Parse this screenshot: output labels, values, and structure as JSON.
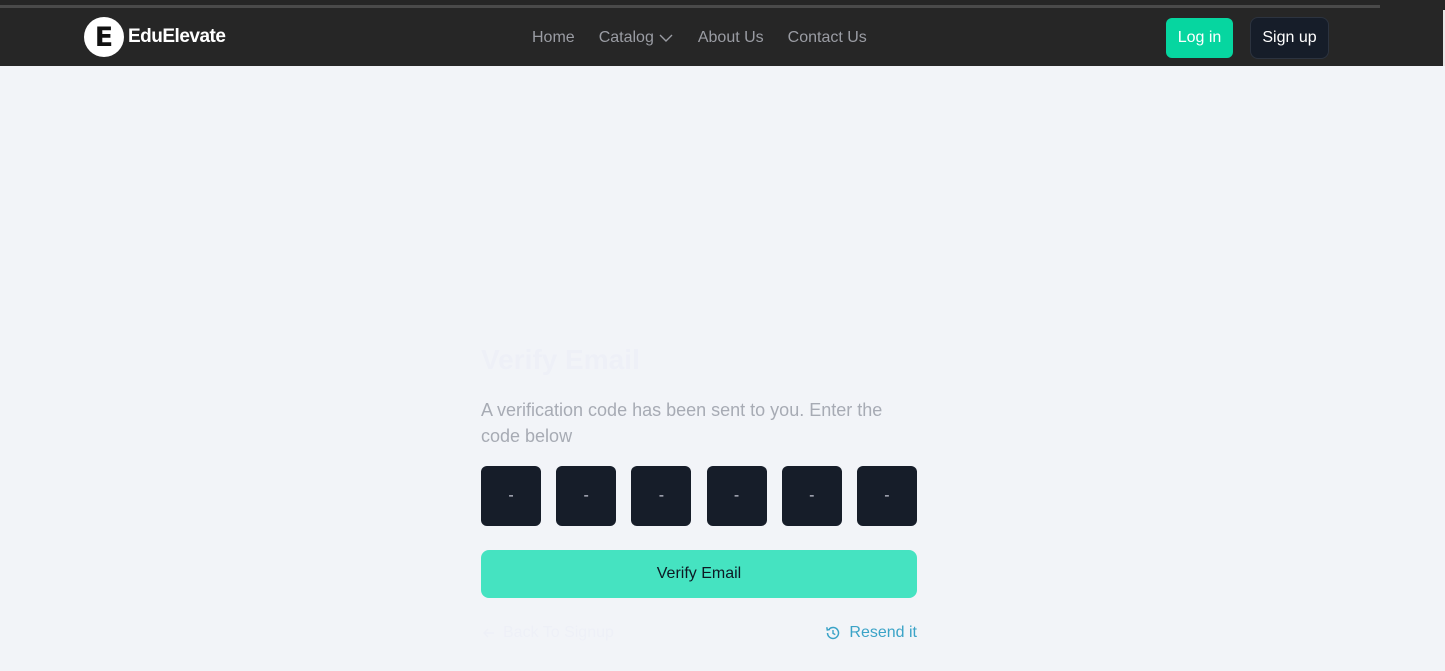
{
  "brand": {
    "name": "EduElevate",
    "logo_letter": "E"
  },
  "nav": {
    "links": [
      {
        "label": "Home"
      },
      {
        "label": "Catalog"
      },
      {
        "label": "About Us"
      },
      {
        "label": "Contact Us"
      }
    ],
    "login_label": "Log in",
    "signup_label": "Sign up"
  },
  "verify": {
    "title": "Verify Email",
    "description": "A verification code has been sent to you. Enter the code below",
    "otp_placeholder": "-",
    "button_label": "Verify Email",
    "back_label": "Back To Signup",
    "resend_label": "Resend it"
  },
  "colors": {
    "accent": "#06d6a0",
    "verify_button": "#45e3c1",
    "resend_link": "#3ba3c7",
    "navbar_bg": "#262626",
    "page_bg": "#f2f4f8"
  },
  "icons": {
    "catalog_dropdown": "chevron-down-icon",
    "resend": "history-icon",
    "back": "arrow-left-icon"
  }
}
